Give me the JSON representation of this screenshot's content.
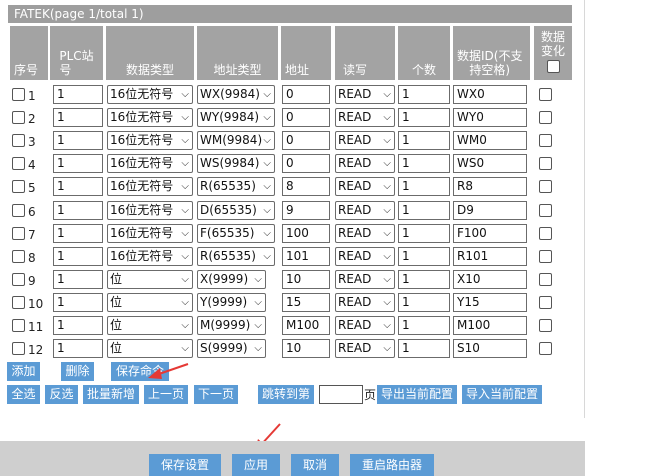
{
  "table": {
    "title": "FATEK(page 1/total 1)",
    "headers": {
      "index": "序号",
      "plc": [
        "PLC站",
        "号"
      ],
      "data_type": "数据类型",
      "addr_type": "地址类型",
      "addr": "地址",
      "rw": "读写",
      "count": "个数",
      "data_id": [
        "数据ID(不支",
        "持空格)"
      ],
      "changed": [
        "数据",
        "变化"
      ]
    },
    "rows": [
      {
        "n": "1",
        "plc": "1",
        "dtype": "16位无符号",
        "atype": "WX(9984)",
        "addr": "0",
        "rw": "READ",
        "count": "1",
        "id": "WX0"
      },
      {
        "n": "2",
        "plc": "1",
        "dtype": "16位无符号",
        "atype": "WY(9984)",
        "addr": "0",
        "rw": "READ",
        "count": "1",
        "id": "WY0"
      },
      {
        "n": "3",
        "plc": "1",
        "dtype": "16位无符号",
        "atype": "WM(9984)",
        "addr": "0",
        "rw": "READ",
        "count": "1",
        "id": "WM0"
      },
      {
        "n": "4",
        "plc": "1",
        "dtype": "16位无符号",
        "atype": "WS(9984)",
        "addr": "0",
        "rw": "READ",
        "count": "1",
        "id": "WS0"
      },
      {
        "n": "5",
        "plc": "1",
        "dtype": "16位无符号",
        "atype": "R(65535)",
        "addr": "8",
        "rw": "READ",
        "count": "1",
        "id": "R8"
      },
      {
        "n": "6",
        "plc": "1",
        "dtype": "16位无符号",
        "atype": "D(65535)",
        "addr": "9",
        "rw": "READ",
        "count": "1",
        "id": "D9"
      },
      {
        "n": "7",
        "plc": "1",
        "dtype": "16位无符号",
        "atype": "F(65535)",
        "addr": "100",
        "rw": "READ",
        "count": "1",
        "id": "F100"
      },
      {
        "n": "8",
        "plc": "1",
        "dtype": "16位无符号",
        "atype": "R(65535)",
        "addr": "101",
        "rw": "READ",
        "count": "1",
        "id": "R101"
      },
      {
        "n": "9",
        "plc": "1",
        "dtype": "位",
        "atype": "X(9999)",
        "addr": "10",
        "rw": "READ",
        "count": "1",
        "id": "X10"
      },
      {
        "n": "10",
        "plc": "1",
        "dtype": "位",
        "atype": "Y(9999)",
        "addr": "15",
        "rw": "READ",
        "count": "1",
        "id": "Y15"
      },
      {
        "n": "11",
        "plc": "1",
        "dtype": "位",
        "atype": "M(9999)",
        "addr": "M100",
        "rw": "READ",
        "count": "1",
        "id": "M100"
      },
      {
        "n": "12",
        "plc": "1",
        "dtype": "位",
        "atype": "S(9999)",
        "addr": "10",
        "rw": "READ",
        "count": "1",
        "id": "S10"
      }
    ]
  },
  "actions": {
    "add": "添加",
    "delete": "删除",
    "save_cmd": "保存命令",
    "select_all": "全选",
    "invert": "反选",
    "batch_add": "批量新增",
    "prev_page": "上一页",
    "next_page": "下一页",
    "jump_to": "跳转到第",
    "page_suffix": "页",
    "export_cfg": "导出当前配置",
    "import_cfg": "导入当前配置"
  },
  "footer": {
    "save_settings": "保存设置",
    "apply": "应用",
    "cancel": "取消",
    "reboot": "重启路由器"
  },
  "colors": {
    "header_bg": "#a3a3a3",
    "button_bg": "#5b9bd5",
    "arrow": "#e53935"
  },
  "icons": {
    "dropdown": "chevron-down-icon",
    "annotation": "red-arrow-icon"
  }
}
